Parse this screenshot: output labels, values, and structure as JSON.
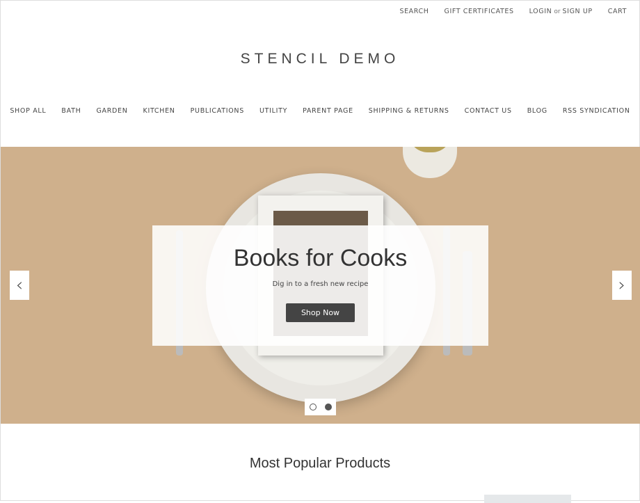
{
  "utility": {
    "search": "SEARCH",
    "gift": "GIFT CERTIFICATES",
    "login": "LOGIN",
    "or": "or",
    "signup": "SIGN UP",
    "cart": "CART"
  },
  "logo": "STENCIL DEMO",
  "nav": [
    "SHOP ALL",
    "BATH",
    "GARDEN",
    "KITCHEN",
    "PUBLICATIONS",
    "UTILITY",
    "PARENT PAGE",
    "SHIPPING & RETURNS",
    "CONTACT US",
    "BLOG",
    "RSS SYNDICATION"
  ],
  "hero": {
    "title": "Books for Cooks",
    "subtitle": "Dig in to a fresh new recipe",
    "button": "Shop Now",
    "prev": "‹",
    "next": "›",
    "slides": 2,
    "active_slide": 2,
    "background": "#cfb08c"
  },
  "popular": {
    "title": "Most Popular Products"
  }
}
